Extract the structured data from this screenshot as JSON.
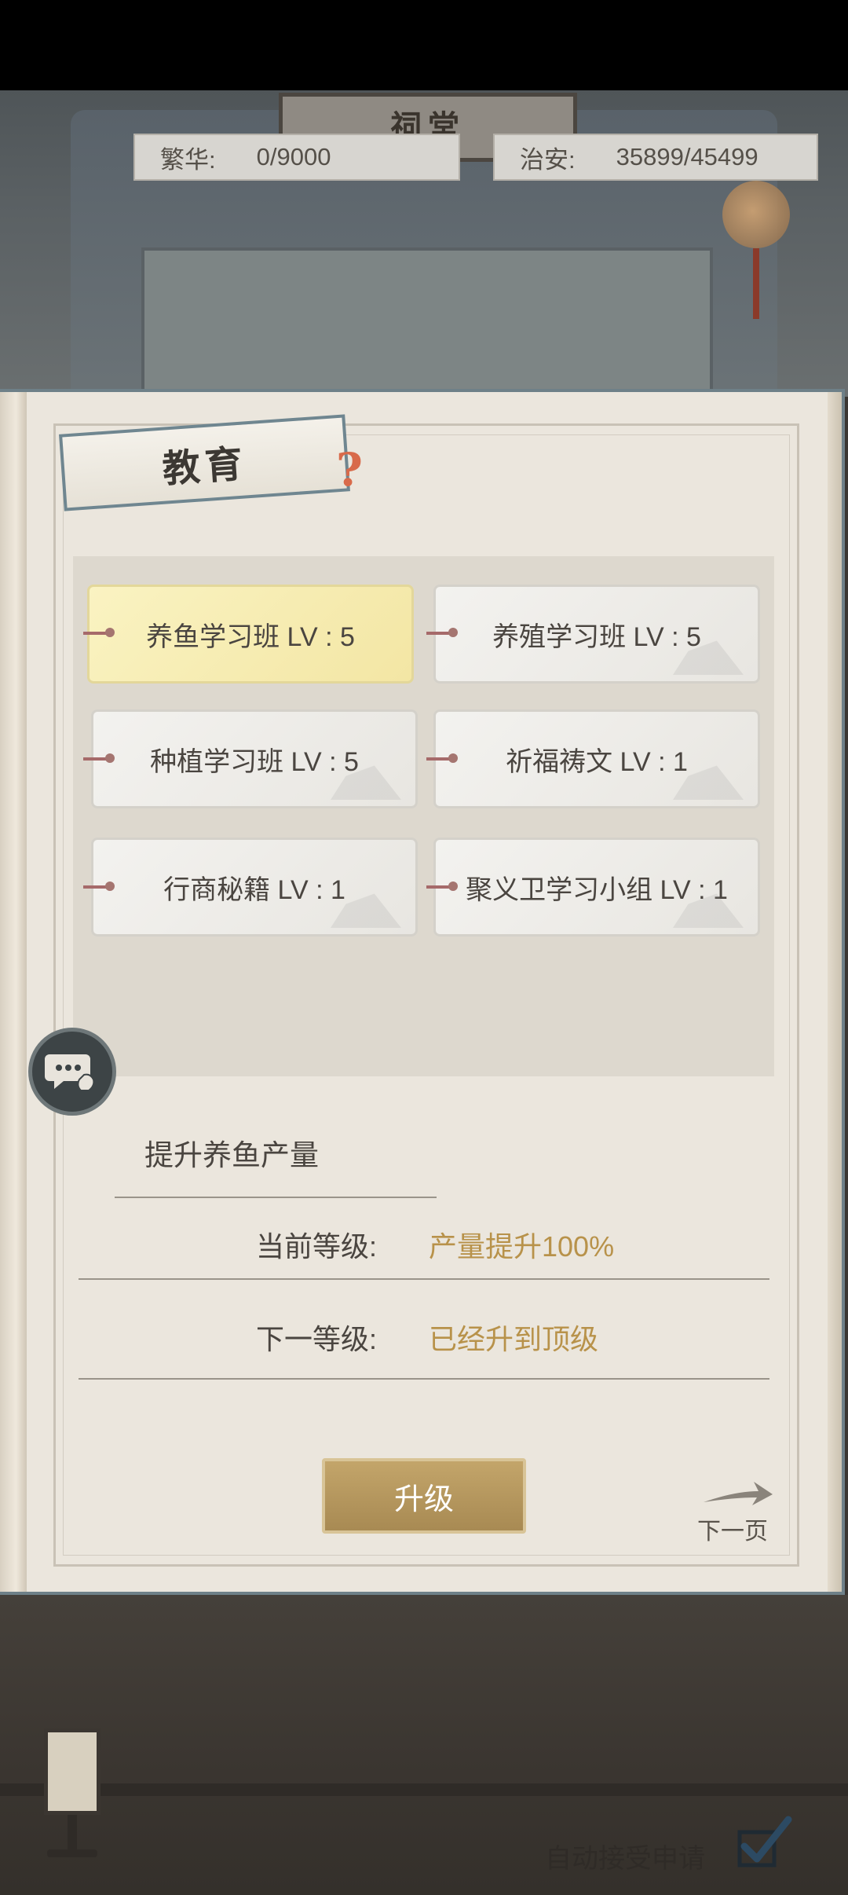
{
  "background": {
    "hall_sign": "祠堂"
  },
  "stats": {
    "fanhua_label": "繁华:",
    "fanhua_value": "0/9000",
    "zhian_label": "治安:",
    "zhian_value": "35899/45499"
  },
  "panel": {
    "tab_title": "教育",
    "help_icon": "question-icon",
    "skills": [
      {
        "label": "养鱼学习班 LV : 5",
        "selected": true
      },
      {
        "label": "养殖学习班 LV : 5",
        "selected": false
      },
      {
        "label": "种植学习班 LV : 5",
        "selected": false
      },
      {
        "label": "祈福祷文 LV : 1",
        "selected": false
      },
      {
        "label": "行商秘籍 LV : 1",
        "selected": false
      },
      {
        "label": "聚义卫学习小组 LV : 1",
        "selected": false
      }
    ],
    "description": "提升养鱼产量",
    "current_level_label": "当前等级:",
    "current_level_value": "产量提升100%",
    "next_level_label": "下一等级:",
    "next_level_value": "已经升到顶级",
    "upgrade_button": "升级",
    "next_page": "下一页"
  },
  "footer": {
    "auto_accept_label": "自动接受申请",
    "auto_accept_checked": true
  },
  "colors": {
    "accent_gold": "#b8924a",
    "button_gold": "#b39660",
    "selected_yellow": "#f6edb5",
    "frame_blue": "#6e8088"
  }
}
